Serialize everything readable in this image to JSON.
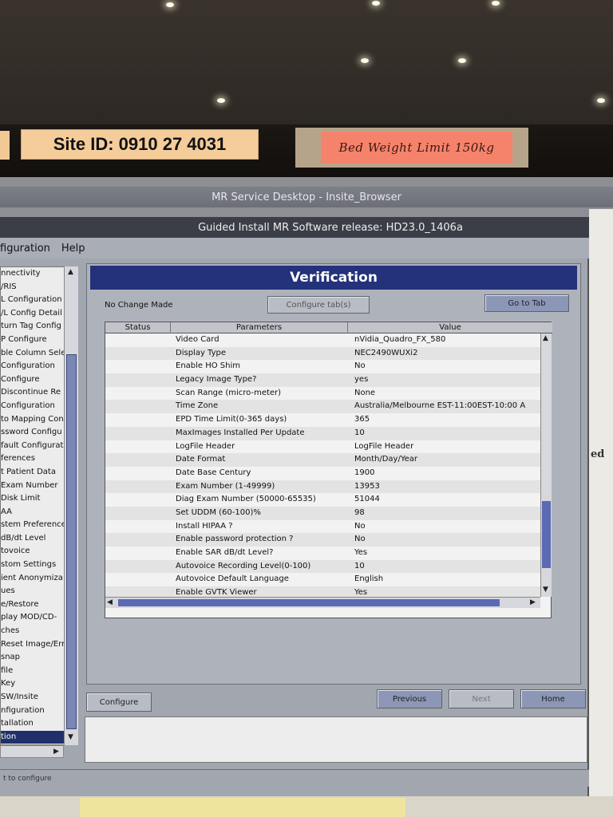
{
  "labels": {
    "site_id": "Site ID: 0910 27 4031",
    "bed_weight": "Bed Weight Limit 150kg"
  },
  "desktop": {
    "title": "MR Service Desktop - Insite_Browser",
    "right_text": "ed"
  },
  "window": {
    "title": "Guided Install  MR Software release: HD23.0_1406a",
    "menu": [
      "Configuration",
      "Help"
    ],
    "menu_visible": [
      "figuration",
      "Help"
    ]
  },
  "side_list": {
    "items": [
      "nnectivity",
      "/RIS",
      "L Configuration",
      "/L Config Detail",
      "turn Tag Config",
      "P Configure",
      "ble Column Sele",
      "Configuration",
      "Configure",
      "Discontinue Re",
      "Configuration",
      "to Mapping Con",
      "ssword Configu",
      "fault Configurat",
      "ferences",
      "t Patient Data",
      "Exam Number",
      "Disk Limit",
      "AA",
      "stem Preferences",
      "dB/dt Level",
      "tovoice",
      "stom Settings",
      "ient Anonymiza",
      "ues",
      "e/Restore",
      "play MOD/CD-",
      "ches",
      "Reset Image/Err",
      "snap",
      "file",
      "Key",
      "SW/Insite",
      "nfiguration",
      "tallation",
      "tion"
    ],
    "selected_index": 35
  },
  "verification": {
    "header": "Verification",
    "change_status": "No Change Made",
    "configure_tabs_button": "Configure tab(s)",
    "go_to_tab_button": "Go to Tab",
    "columns": [
      "Status",
      "Parameters",
      "Value"
    ],
    "rows": [
      {
        "param": "Video Card",
        "value": "nVidia_Quadro_FX_580"
      },
      {
        "param": "Display Type",
        "value": "NEC2490WUXi2"
      },
      {
        "param": "Enable HO Shim",
        "value": "No"
      },
      {
        "param": "Legacy Image Type?",
        "value": "yes"
      },
      {
        "param": "Scan Range (micro-meter)",
        "value": "None"
      },
      {
        "param": "Time Zone",
        "value": "Australia/Melbourne EST-11:00EST-10:00 A"
      },
      {
        "param": "EPD Time Limit(0-365 days)",
        "value": "365"
      },
      {
        "param": "MaxImages Installed Per Update",
        "value": "10"
      },
      {
        "param": "LogFile Header",
        "value": "LogFile Header"
      },
      {
        "param": "Date Format",
        "value": "Month/Day/Year"
      },
      {
        "param": "Date Base Century",
        "value": "1900"
      },
      {
        "param": "Exam Number (1-49999)",
        "value": "13953"
      },
      {
        "param": "Diag Exam Number (50000-65535)",
        "value": "51044"
      },
      {
        "param": "Set UDDM (60-100)%",
        "value": "98"
      },
      {
        "param": "Install HIPAA ?",
        "value": "No"
      },
      {
        "param": "Enable password protection ?",
        "value": "No"
      },
      {
        "param": "Enable SAR dB/dt Level?",
        "value": "Yes"
      },
      {
        "param": "Autovoice Recording Level(0-100)",
        "value": "10"
      },
      {
        "param": "Autovoice Default Language",
        "value": "English"
      },
      {
        "param": "Enable GVTK Viewer",
        "value": "Yes"
      }
    ]
  },
  "buttons": {
    "configure": "Configure",
    "previous": "Previous",
    "next": "Next",
    "home": "Home"
  },
  "status_bar": "t to configure",
  "colors": {
    "header_blue": "#23327a",
    "selected_blue": "#20306a",
    "site_label": "#f4cd9b",
    "bed_label": "#f5836b"
  }
}
